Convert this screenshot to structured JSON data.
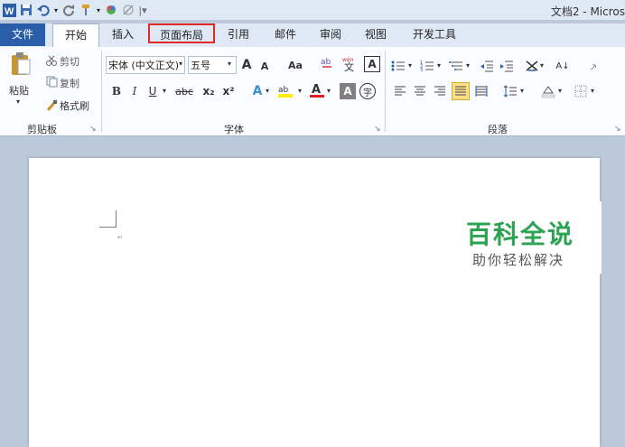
{
  "window": {
    "title": "文档2 - Micros"
  },
  "tabs": [
    {
      "label": "文件"
    },
    {
      "label": "开始"
    },
    {
      "label": "插入"
    },
    {
      "label": "页面布局"
    },
    {
      "label": "引用"
    },
    {
      "label": "邮件"
    },
    {
      "label": "审阅"
    },
    {
      "label": "视图"
    },
    {
      "label": "开发工具"
    }
  ],
  "clipboard": {
    "paste": "粘贴",
    "cut": "剪切",
    "copy": "复制",
    "format_painter": "格式刷",
    "group_label": "剪贴板"
  },
  "font": {
    "family": "宋体 (中文正文)",
    "size": "五号",
    "group_label": "字体",
    "bold": "B",
    "italic": "I",
    "underline": "U",
    "strike": "abc",
    "subscript": "x₂",
    "superscript": "x²",
    "grow": "A",
    "shrink": "A",
    "case": "Aa",
    "pinyin": "wén",
    "wen_char": "文",
    "border_char": "A",
    "highlight": "aby",
    "color": "A",
    "shade": "A",
    "enclose": "字"
  },
  "paragraph": {
    "group_label": "段落",
    "sort": "A↓"
  },
  "watermark": {
    "main": "百科全说",
    "sub": "助你轻松解决"
  },
  "colors": {
    "file_tab": "#2b5ea8",
    "highlight_box": "#e02a2a",
    "watermark_green": "#2ba353"
  }
}
